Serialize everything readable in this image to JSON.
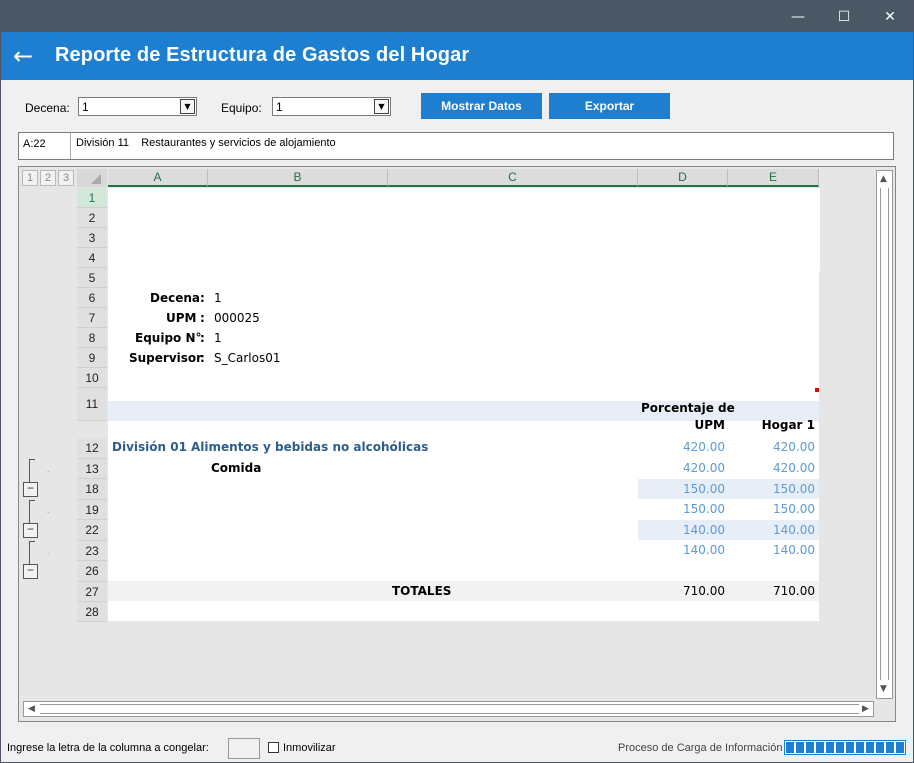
{
  "window": {
    "minimize": "—",
    "maximize": "☐",
    "close": "✕"
  },
  "header": {
    "title": "Reporte de Estructura de Gastos del Hogar",
    "back": "←"
  },
  "controls": {
    "decena_label": "Decena:",
    "decena_value": "1",
    "equipo_label": "Equipo:",
    "equipo_value": "1",
    "show_button": "Mostrar Datos",
    "export_button": "Exportar"
  },
  "formula_bar": {
    "cell_ref": "A:22",
    "content": "División 11    Restaurantes y servicios de alojamiento"
  },
  "grid": {
    "outline_levels": [
      "1",
      "2",
      "3"
    ],
    "columns": [
      "A",
      "B",
      "C",
      "D",
      "E"
    ],
    "rows": [
      "1",
      "2",
      "3",
      "4",
      "5",
      "6",
      "7",
      "8",
      "9",
      "10",
      "11",
      "12",
      "13",
      "18",
      "19",
      "22",
      "23",
      "26",
      "27",
      "28"
    ],
    "info": {
      "decena_label": "Decena",
      "decena_value": "1",
      "upm_label": "UPM",
      "upm_value": "000025",
      "equipo_label": "Equipo N°",
      "equipo_value": "1",
      "supervisor_label": "Supervisor",
      "supervisor_value": "S_Carlos01",
      "colon": ":"
    },
    "col_headers": {
      "d_line1": "Porcentaje de",
      "d_line2": "UPM",
      "e": "Hogar 1"
    },
    "division": {
      "label": "División 01",
      "desc": "Alimentos y bebidas no alcohólicas",
      "d": "420.00",
      "e": "420.00"
    },
    "comida": {
      "label": "Comida",
      "d": "420.00",
      "e": "420.00"
    },
    "r18": {
      "d": "150.00",
      "e": "150.00"
    },
    "r19": {
      "d": "150.00",
      "e": "150.00"
    },
    "r22": {
      "d": "140.00",
      "e": "140.00"
    },
    "r23": {
      "d": "140.00",
      "e": "140.00"
    },
    "totales": {
      "label": "TOTALES",
      "d": "710.00",
      "e": "710.00"
    }
  },
  "status_bar": {
    "freeze_label": "Ingrese la letra de la columna a congelar:",
    "freeze_value": "",
    "immobilize_label": "Inmovilizar",
    "load_label": "Proceso de Carga de Información",
    "load_progress": 1.0
  },
  "colors": {
    "accent": "#1e7fd0",
    "titlebar": "#4a5866",
    "excel_green": "#217346",
    "division_blue": "#2f5d8a",
    "value_blue": "#5b9bd5"
  }
}
